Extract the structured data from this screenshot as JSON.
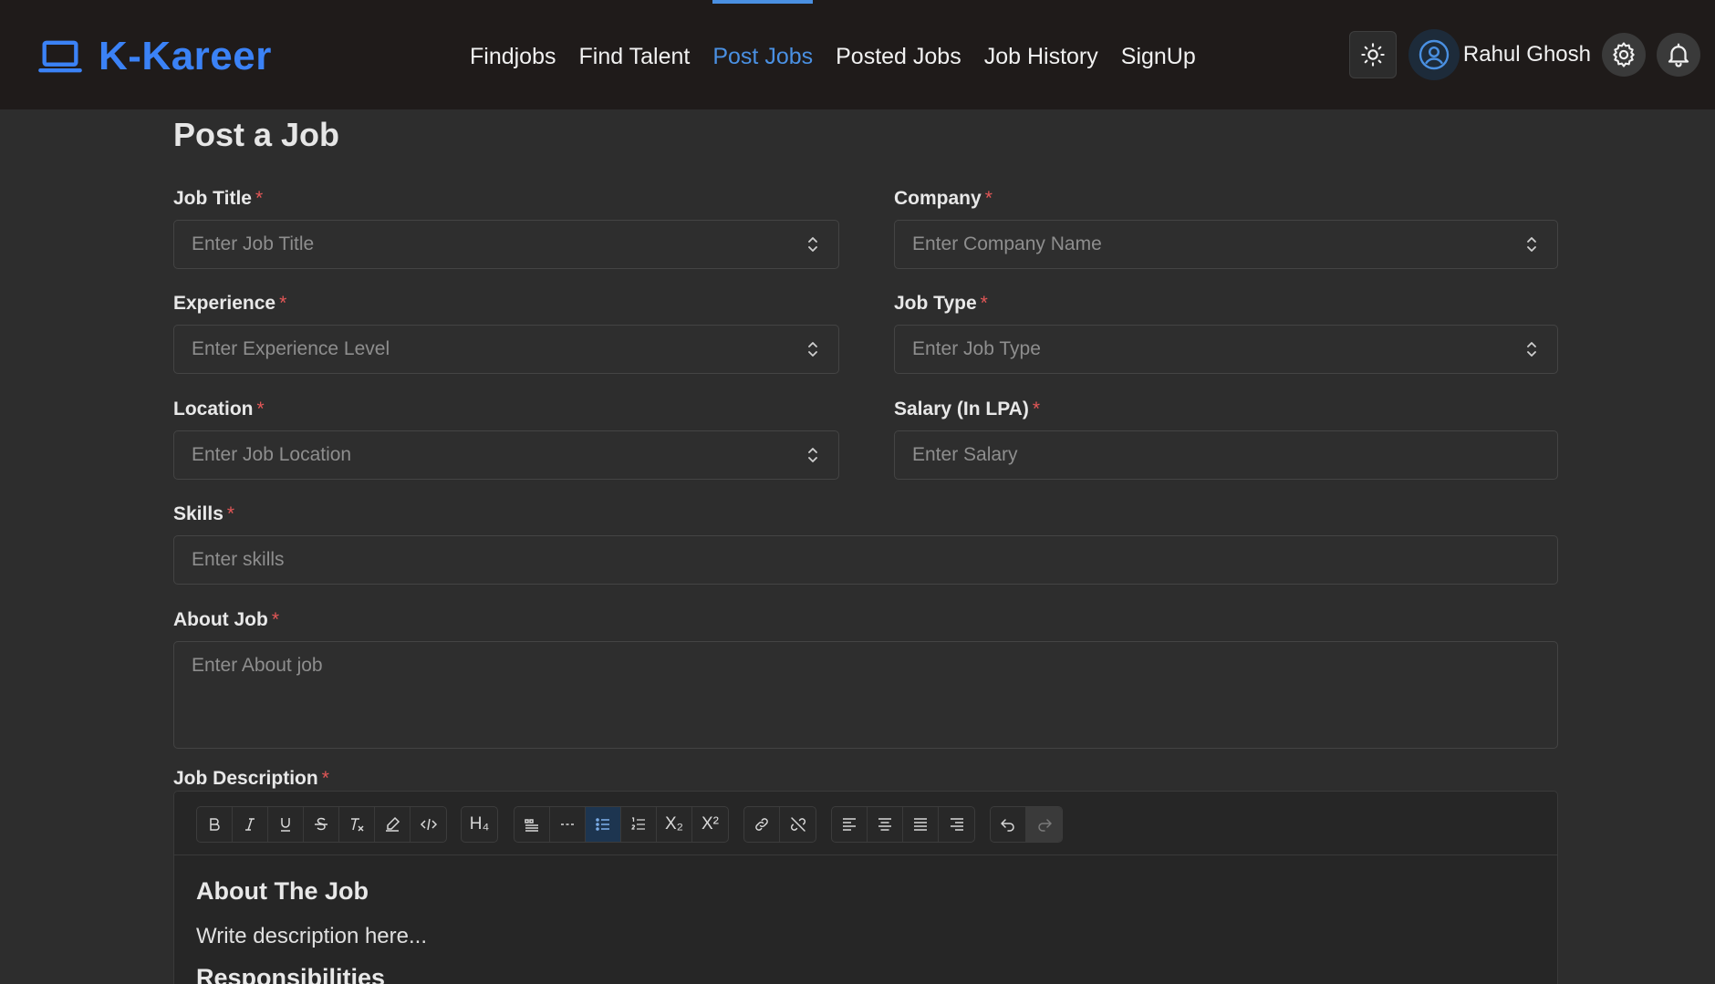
{
  "header": {
    "brand": "K-Kareer",
    "nav": [
      "Findjobs",
      "Find Talent",
      "Post Jobs",
      "Posted Jobs",
      "Job History",
      "SignUp"
    ],
    "active_nav": "Post Jobs",
    "user_name": "Rahul Ghosh"
  },
  "page": {
    "title": "Post a Job"
  },
  "form": {
    "job_title": {
      "label": "Job Title",
      "placeholder": "Enter Job Title"
    },
    "company": {
      "label": "Company",
      "placeholder": "Enter Company Name"
    },
    "experience": {
      "label": "Experience",
      "placeholder": "Enter Experience Level"
    },
    "job_type": {
      "label": "Job Type",
      "placeholder": "Enter Job Type"
    },
    "location": {
      "label": "Location",
      "placeholder": "Enter Job Location"
    },
    "salary": {
      "label": "Salary (In LPA)",
      "placeholder": "Enter Salary"
    },
    "skills": {
      "label": "Skills",
      "placeholder": "Enter skills"
    },
    "about": {
      "label": "About Job",
      "placeholder": "Enter About job"
    },
    "description": {
      "label": "Job Description"
    },
    "required_mark": "*"
  },
  "editor": {
    "heading": "About The Job",
    "paragraph": "Write description here...",
    "heading2": "Responsibilities",
    "toolbar_text": {
      "h4": "H₄",
      "subscript": "X₂",
      "superscript": "X²"
    }
  },
  "colors": {
    "accent": "#4a90e2",
    "brand": "#3b82f6",
    "required": "#e35757",
    "header_bg": "#1f1b1a",
    "page_bg": "#2d2d2d"
  }
}
